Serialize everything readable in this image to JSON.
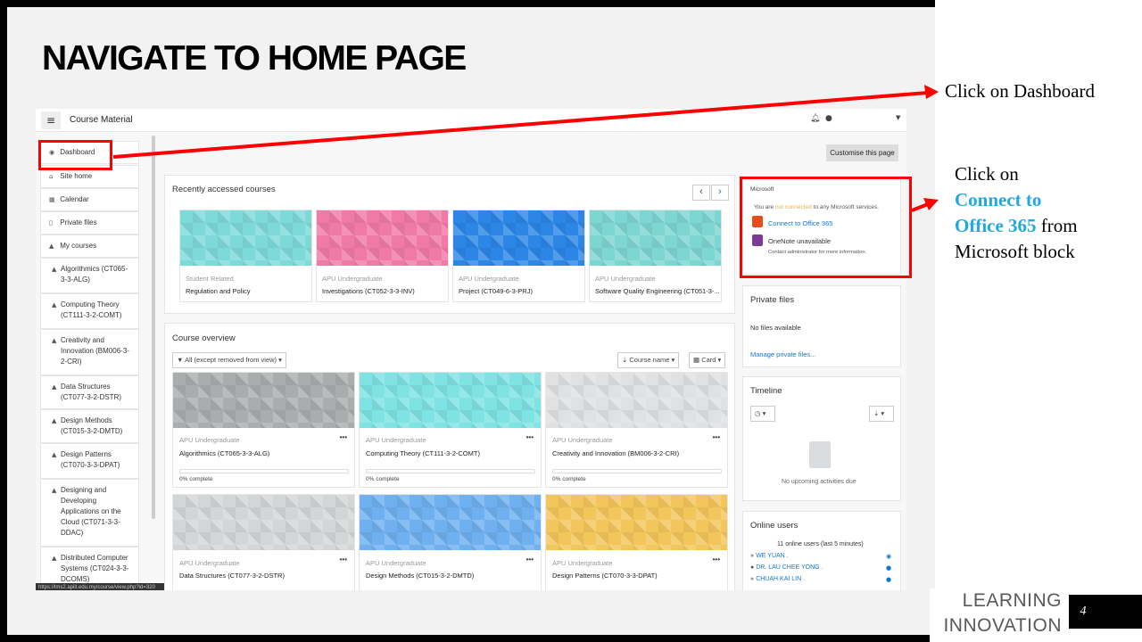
{
  "slide": {
    "title": "NAVIGATE TO HOME PAGE",
    "page_number": "4",
    "brand": [
      "LEARNING",
      "INNOVATION"
    ]
  },
  "annotations": {
    "dashboard_note": "Click on Dashboard",
    "ms_note_1": "Click on",
    "ms_note_hl_1": "Connect to",
    "ms_note_hl_2": "Office 365",
    "ms_note_2": "from",
    "ms_note_3": "Microsoft block",
    "arrow_color": "#ff0000",
    "highlight_color": "#1fa9e1"
  },
  "topbar": {
    "menu_icon": "≡",
    "site_name": "Course Material",
    "bell_icon": "bell-icon",
    "chat_icon": "chat-icon"
  },
  "nav": {
    "items": [
      {
        "label": "Dashboard",
        "icon": "dashboard-icon"
      },
      {
        "label": "Site home",
        "icon": "home-icon"
      },
      {
        "label": "Calendar",
        "icon": "calendar-icon"
      },
      {
        "label": "Private files",
        "icon": "file-icon"
      },
      {
        "label": "My courses",
        "icon": "graduation-cap-icon"
      },
      {
        "label": "Algorithmics (CT065-3-3-ALG)",
        "icon": "graduation-cap-icon"
      },
      {
        "label": "Computing Theory (CT111-3-2-COMT)",
        "icon": "graduation-cap-icon"
      },
      {
        "label": "Creativity and Innovation (BM006-3-2-CRI)",
        "icon": "graduation-cap-icon"
      },
      {
        "label": "Data Structures (CT077-3-2-DSTR)",
        "icon": "graduation-cap-icon"
      },
      {
        "label": "Design Methods (CT015-3-2-DMTD)",
        "icon": "graduation-cap-icon"
      },
      {
        "label": "Design Patterns (CT070-3-3-DPAT)",
        "icon": "graduation-cap-icon"
      },
      {
        "label": "Designing and Developing Applications on the Cloud (CT071-3-3-DDAC)",
        "icon": "graduation-cap-icon"
      },
      {
        "label": "Distributed Computer Systems (CT024-3-3-DCOMS)",
        "icon": "graduation-cap-icon"
      }
    ],
    "status_url": "https://lms2.apiit.edu.my/course/view.php?id=320"
  },
  "main": {
    "customise_label": "Customise this page",
    "recent": {
      "title": "Recently accessed courses",
      "prev_icon": "‹",
      "next_icon": "›",
      "cards": [
        {
          "category": "Student Related",
          "name": "Regulation and Policy",
          "color": "#7ed9d9"
        },
        {
          "category": "APU Undergraduate",
          "name": "Investigations (CT052-3-3-INV)",
          "color": "#f07aa6"
        },
        {
          "category": "APU Undergraduate",
          "name": "Project (CT049-6-3-PRJ)",
          "color": "#2b86e6"
        },
        {
          "category": "APU Undergraduate",
          "name": "Software Quality Engineering (CT051-3-...",
          "color": "#7ed6d3"
        }
      ]
    },
    "overview": {
      "title": "Course overview",
      "filter_label": "All (except removed from view)",
      "sort_label": "Course name",
      "view_label": "Card",
      "cards": [
        {
          "category": "APU Undergraduate",
          "name": "Algorithmics (CT065-3-3-ALG)",
          "progress": "0% complete",
          "color": "#a9adae"
        },
        {
          "category": "APU Undergraduate",
          "name": "Computing Theory (CT111-3-2-COMT)",
          "progress": "0% complete",
          "color": "#7ee3e2"
        },
        {
          "category": "APU Undergraduate",
          "name": "Creativity and Innovation (BM006-3-2-CRI)",
          "progress": "0% complete",
          "color": "#dfe1e2"
        },
        {
          "category": "APU Undergraduate",
          "name": "Data Structures (CT077-3-2-DSTR)",
          "color": "#d3d6d7"
        },
        {
          "category": "APU Undergraduate",
          "name": "Design Methods (CT015-3-2-DMTD)",
          "color": "#6fb0f0"
        },
        {
          "category": "APU Undergraduate",
          "name": "Design Patterns (CT070-3-3-DPAT)",
          "color": "#f3c65c"
        }
      ],
      "more_icon": "•••"
    }
  },
  "right": {
    "microsoft": {
      "title": "Microsoft",
      "status_pre": "You are ",
      "status_warn": "not connected",
      "status_post": " to any Microsoft services.",
      "connect_label": "Connect to Office 365",
      "onenote_label": "OneNote unavailable",
      "onenote_note": "Contact administrator for more information."
    },
    "private_files": {
      "title": "Private files",
      "empty": "No files available",
      "manage": "Manage private files..."
    },
    "timeline": {
      "title": "Timeline",
      "empty": "No upcoming activities due"
    },
    "online_users": {
      "title": "Online users",
      "summary": "11 online users (last 5 minutes)",
      "users": [
        "WE YUAN .",
        "DR. LAU CHEE YONG .",
        "CHUAH KAI LIN ."
      ]
    }
  }
}
